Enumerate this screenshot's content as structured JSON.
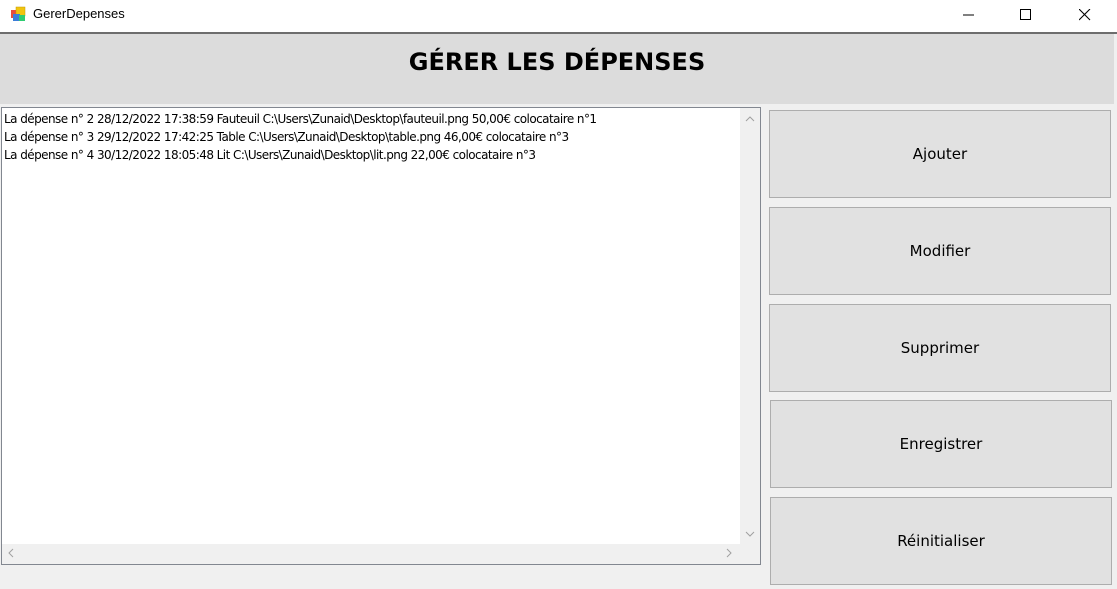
{
  "window": {
    "title": "GererDepenses",
    "app_icon": "winforms-app-icon",
    "controls": [
      "minimize-icon",
      "maximize-icon",
      "close-icon"
    ]
  },
  "header": {
    "title": "GÉRER LES DÉPENSES"
  },
  "expenses_list": {
    "items": [
      "La dépense n° 2 28/12/2022 17:38:59 Fauteuil C:\\Users\\Zunaid\\Desktop\\fauteuil.png 50,00€ colocataire n°1",
      "La dépense n° 3 29/12/2022 17:42:25 Table C:\\Users\\Zunaid\\Desktop\\table.png 46,00€ colocataire n°3",
      "La dépense n° 4 30/12/2022 18:05:48 Lit C:\\Users\\Zunaid\\Desktop\\lit.png 22,00€ colocataire n°3"
    ]
  },
  "actions": {
    "ajouter": "Ajouter",
    "modifier": "Modifier",
    "supprimer": "Supprimer",
    "enregistrer": "Enregistrer",
    "reinitialiser": "Réinitialiser"
  },
  "colors": {
    "header_bg": "#dcdcdc",
    "button_bg": "#e1e1e1",
    "window_bg": "#f0f0f0"
  }
}
